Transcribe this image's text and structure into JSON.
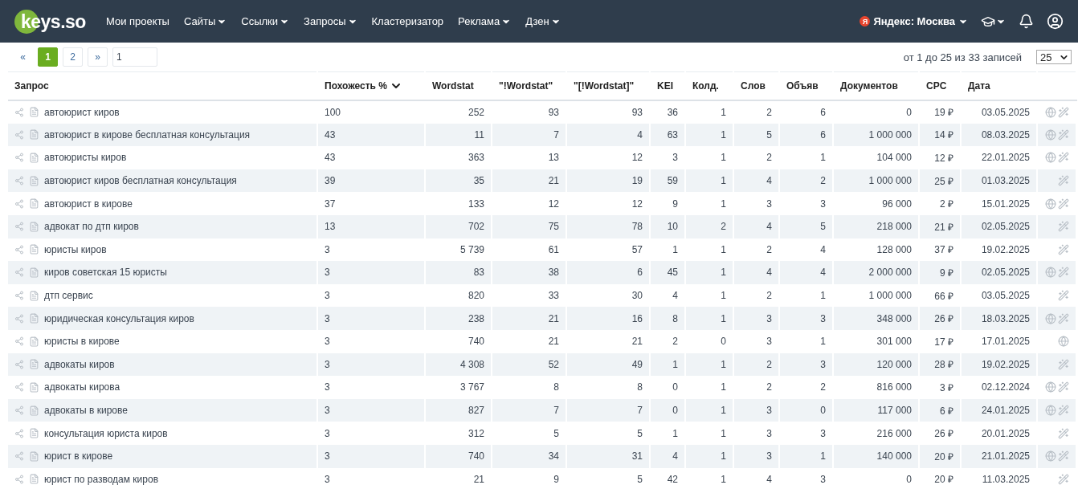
{
  "header": {
    "logo": "keys.so",
    "nav": [
      {
        "label": "Мои проекты",
        "dropdown": false
      },
      {
        "label": "Сайты",
        "dropdown": true
      },
      {
        "label": "Ссылки",
        "dropdown": true
      },
      {
        "label": "Запросы",
        "dropdown": true
      },
      {
        "label": "Кластеризатор",
        "dropdown": false
      },
      {
        "label": "Реклама",
        "dropdown": true
      },
      {
        "label": "Дзен",
        "dropdown": true
      }
    ],
    "region_badge": "Я",
    "region": "Яндекс: Москва"
  },
  "pagination": {
    "prev": "«",
    "next": "»",
    "pages": [
      {
        "label": "1",
        "selected": true
      },
      {
        "label": "2",
        "selected": false
      }
    ],
    "page_input": "1",
    "info": "от 1 до 25 из 33 записей",
    "page_size": "25"
  },
  "table": {
    "columns": [
      {
        "label": "Запрос",
        "sorted": false
      },
      {
        "label": "Похожесть %",
        "sorted": true
      },
      {
        "label": "Wordstat",
        "sorted": false
      },
      {
        "label": "\"!Wordstat\"",
        "sorted": false
      },
      {
        "label": "\"[!Wordstat]\"",
        "sorted": false
      },
      {
        "label": "KEI",
        "sorted": false
      },
      {
        "label": "Колд.",
        "sorted": false
      },
      {
        "label": "Слов",
        "sorted": false
      },
      {
        "label": "Объяв",
        "sorted": false
      },
      {
        "label": "Документов",
        "sorted": false
      },
      {
        "label": "CPC",
        "sorted": false
      },
      {
        "label": "Дата",
        "sorted": false
      }
    ],
    "rows": [
      {
        "cells": [
          "автоюрист киров",
          "100",
          "252",
          "93",
          "93",
          "36",
          "1",
          "2",
          "6",
          "0",
          "19 ₽",
          "03.05.2025"
        ],
        "globe": true,
        "wand": true
      },
      {
        "cells": [
          "автоюрист в кирове бесплатная консультация",
          "43",
          "11",
          "7",
          "4",
          "63",
          "1",
          "5",
          "6",
          "1 000 000",
          "14 ₽",
          "08.03.2025"
        ],
        "globe": true,
        "wand": true
      },
      {
        "cells": [
          "автоюристы киров",
          "43",
          "363",
          "13",
          "12",
          "3",
          "1",
          "2",
          "1",
          "104 000",
          "12 ₽",
          "22.01.2025"
        ],
        "globe": true,
        "wand": true
      },
      {
        "cells": [
          "автоюрист киров бесплатная консультация",
          "39",
          "35",
          "21",
          "19",
          "59",
          "1",
          "4",
          "2",
          "1 000 000",
          "25 ₽",
          "01.03.2025"
        ],
        "globe": false,
        "wand": true
      },
      {
        "cells": [
          "автоюрист в кирове",
          "37",
          "133",
          "12",
          "12",
          "9",
          "1",
          "3",
          "3",
          "96 000",
          "2 ₽",
          "15.01.2025"
        ],
        "globe": true,
        "wand": true
      },
      {
        "cells": [
          "адвокат по дтп киров",
          "13",
          "702",
          "75",
          "78",
          "10",
          "2",
          "4",
          "5",
          "218 000",
          "21 ₽",
          "02.05.2025"
        ],
        "globe": false,
        "wand": true
      },
      {
        "cells": [
          "юристы киров",
          "3",
          "5 739",
          "61",
          "57",
          "1",
          "1",
          "2",
          "4",
          "128 000",
          "37 ₽",
          "19.02.2025"
        ],
        "globe": false,
        "wand": true
      },
      {
        "cells": [
          "киров советская 15 юристы",
          "3",
          "83",
          "38",
          "6",
          "45",
          "1",
          "4",
          "4",
          "2 000 000",
          "9 ₽",
          "02.05.2025"
        ],
        "globe": true,
        "wand": true
      },
      {
        "cells": [
          "дтп сервис",
          "3",
          "820",
          "33",
          "30",
          "4",
          "1",
          "2",
          "1",
          "1 000 000",
          "66 ₽",
          "03.05.2025"
        ],
        "globe": false,
        "wand": true
      },
      {
        "cells": [
          "юридическая консультация киров",
          "3",
          "238",
          "21",
          "16",
          "8",
          "1",
          "3",
          "3",
          "348 000",
          "26 ₽",
          "18.03.2025"
        ],
        "globe": true,
        "wand": true
      },
      {
        "cells": [
          "юристы в кирове",
          "3",
          "740",
          "21",
          "21",
          "2",
          "0",
          "3",
          "1",
          "301 000",
          "17 ₽",
          "17.01.2025"
        ],
        "globe": true,
        "wand": false
      },
      {
        "cells": [
          "адвокаты киров",
          "3",
          "4 308",
          "52",
          "49",
          "1",
          "1",
          "2",
          "3",
          "120 000",
          "28 ₽",
          "19.02.2025"
        ],
        "globe": false,
        "wand": true
      },
      {
        "cells": [
          "адвокаты кирова",
          "3",
          "3 767",
          "8",
          "8",
          "0",
          "1",
          "2",
          "2",
          "816 000",
          "3 ₽",
          "02.12.2024"
        ],
        "globe": true,
        "wand": true
      },
      {
        "cells": [
          "адвокаты в кирове",
          "3",
          "827",
          "7",
          "7",
          "0",
          "1",
          "3",
          "0",
          "117 000",
          "6 ₽",
          "24.01.2025"
        ],
        "globe": true,
        "wand": true
      },
      {
        "cells": [
          "консультация юриста киров",
          "3",
          "312",
          "5",
          "5",
          "1",
          "1",
          "3",
          "3",
          "216 000",
          "26 ₽",
          "20.01.2025"
        ],
        "globe": false,
        "wand": true
      },
      {
        "cells": [
          "юрист в кирове",
          "3",
          "740",
          "34",
          "31",
          "4",
          "1",
          "3",
          "1",
          "140 000",
          "20 ₽",
          "21.01.2025"
        ],
        "globe": true,
        "wand": true
      },
      {
        "cells": [
          "юрист по разводам киров",
          "3",
          "21",
          "9",
          "5",
          "42",
          "1",
          "4",
          "3",
          "0",
          "20 ₽",
          "11.03.2025"
        ],
        "globe": false,
        "wand": true
      }
    ]
  }
}
